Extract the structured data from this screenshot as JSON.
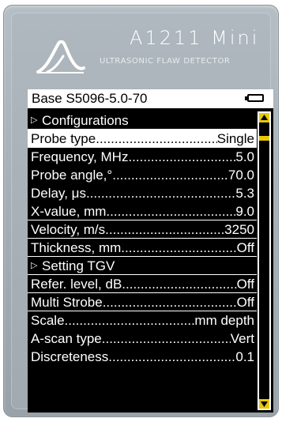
{
  "brand": {
    "title": "A1211 Mini",
    "subtitle": "ULTRASONIC FLAW DETECTOR"
  },
  "header": {
    "title": "Base S5096-5.0-70"
  },
  "menu": {
    "items": [
      {
        "type": "group",
        "label": "Configurations"
      },
      {
        "type": "param",
        "label": "Probe type",
        "value": "Single",
        "selected": true
      },
      {
        "type": "param",
        "label": "Frequency, MHz",
        "value": "5.0"
      },
      {
        "type": "param",
        "label": "Probe angle,°",
        "value": "70.0"
      },
      {
        "type": "param",
        "label": "Delay,  μs",
        "value": "5.3"
      },
      {
        "type": "param",
        "label": "X-value, mm",
        "value": "9.0"
      },
      {
        "type": "param",
        "label": "Velocity, m/s",
        "value": "3250"
      },
      {
        "type": "param",
        "label": "Thickness, mm",
        "value": "Off"
      },
      {
        "type": "group",
        "label": "Setting TGV"
      },
      {
        "type": "param",
        "label": "Refer. level, dB",
        "value": "Off"
      },
      {
        "type": "param",
        "label": "Multi Strobe",
        "value": "Off"
      },
      {
        "type": "param",
        "label": "Scale",
        "value": "mm depth"
      },
      {
        "type": "param",
        "label": "A-scan type",
        "value": "Vert"
      },
      {
        "type": "param",
        "label": "Discreteness",
        "value": "0.1"
      }
    ]
  },
  "scroll": {
    "position_fraction": 0.05
  },
  "colors": {
    "screen_bg": "#000000",
    "text": "#ffffff",
    "highlight_bg": "#ffffff",
    "scroll_accent": "#e8c900",
    "device_body": "#a3adb3"
  },
  "icons": {
    "logo": "wave-logo-icon",
    "battery": "battery-icon",
    "group_arrow": "triangle-right-icon",
    "scroll_up": "arrow-up-icon",
    "scroll_down": "arrow-down-icon"
  }
}
